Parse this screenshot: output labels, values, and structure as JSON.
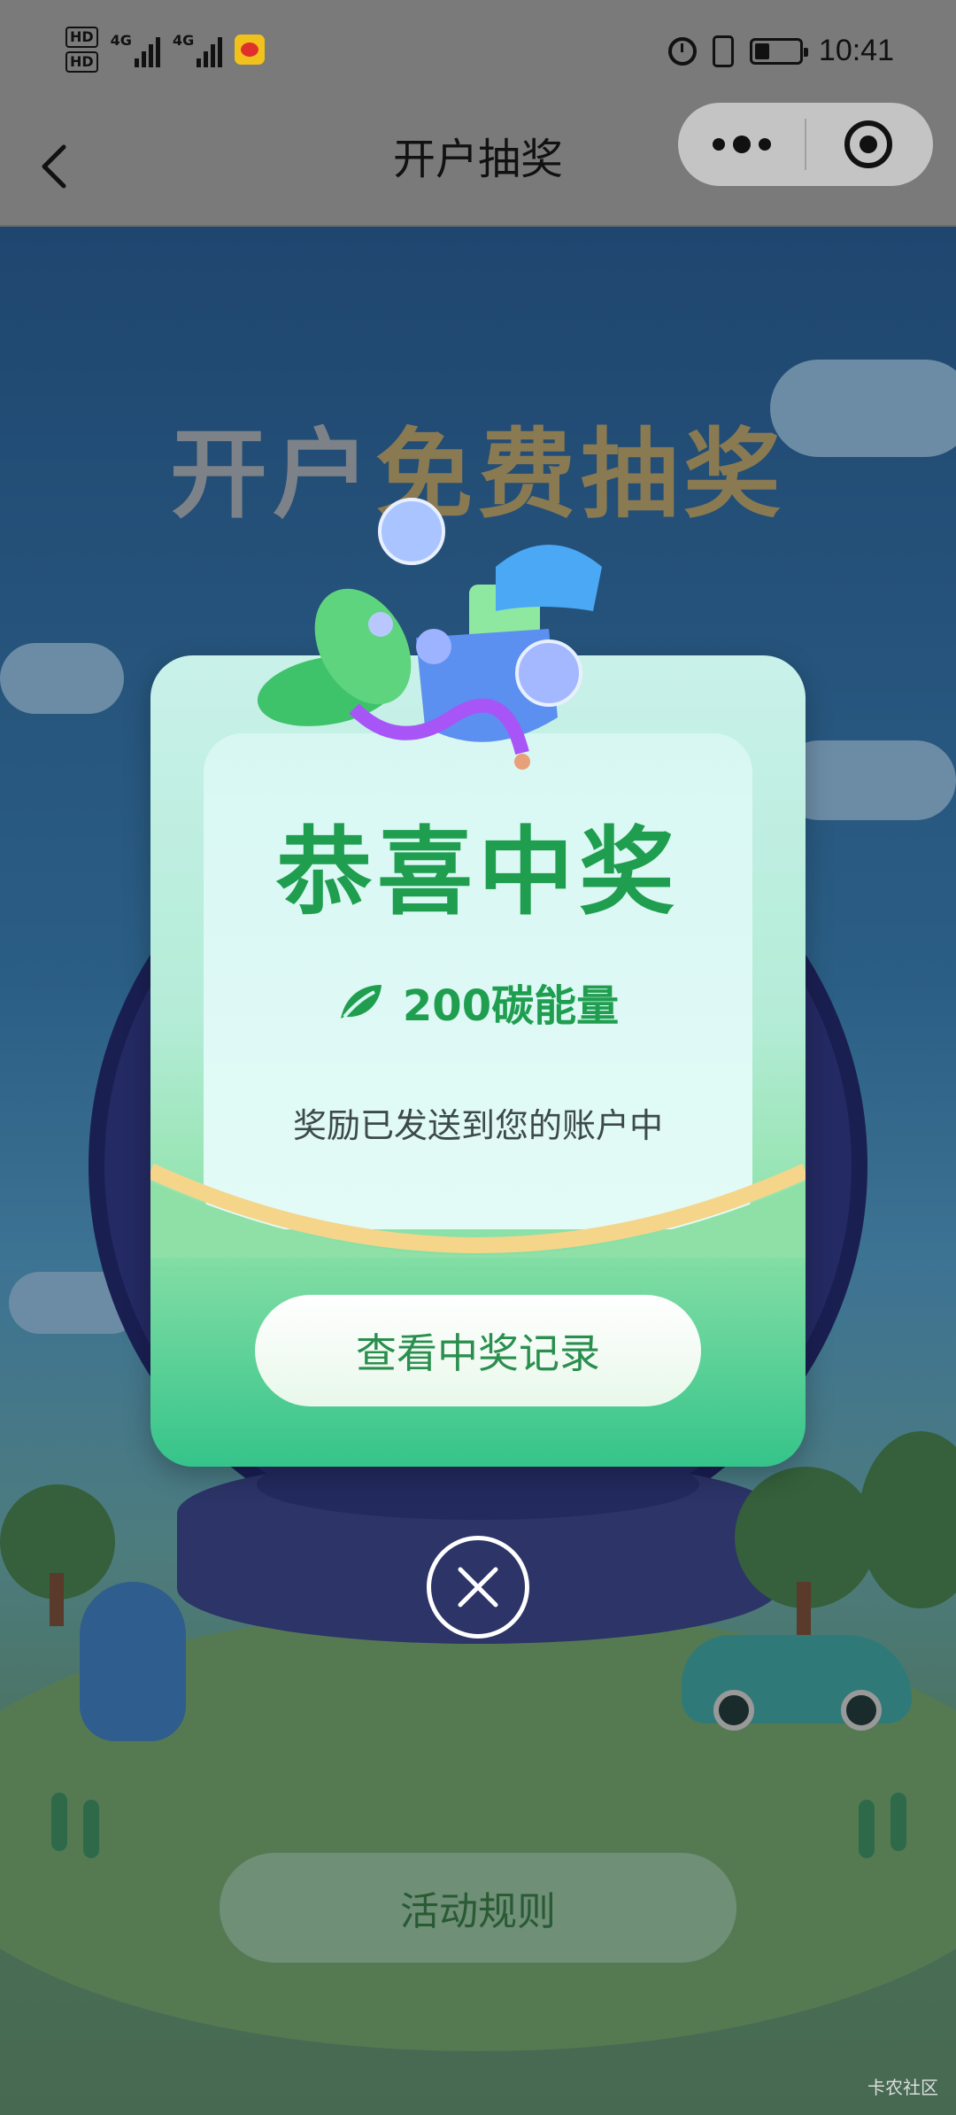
{
  "status_bar": {
    "hd1": "HD",
    "hd2": "HD",
    "net1": "4G",
    "net2": "4G",
    "time": "10:41",
    "icons": [
      "hd-icon",
      "signal-icon",
      "weibo-icon",
      "alarm-icon",
      "vibrate-icon",
      "battery-icon"
    ]
  },
  "nav": {
    "title": "开户抽奖",
    "back_icon": "back-chevron-icon",
    "more_icon": "more-dots-icon",
    "close_icon": "target-close-icon"
  },
  "scene": {
    "title_part1": "开户",
    "title_part2": "免费抽奖",
    "rules_label": "活动规则",
    "watermark": "卡农社区"
  },
  "modal": {
    "title": "恭喜中奖",
    "prize": "200碳能量",
    "description": "奖励已发送到您的账户中",
    "button_label": "查看中奖记录",
    "close_icon": "close-x-icon"
  },
  "colors": {
    "accent_green": "#1f9e4f",
    "overlay_gray": "#7a7a7a",
    "gold_arc": "#f5d58a"
  }
}
